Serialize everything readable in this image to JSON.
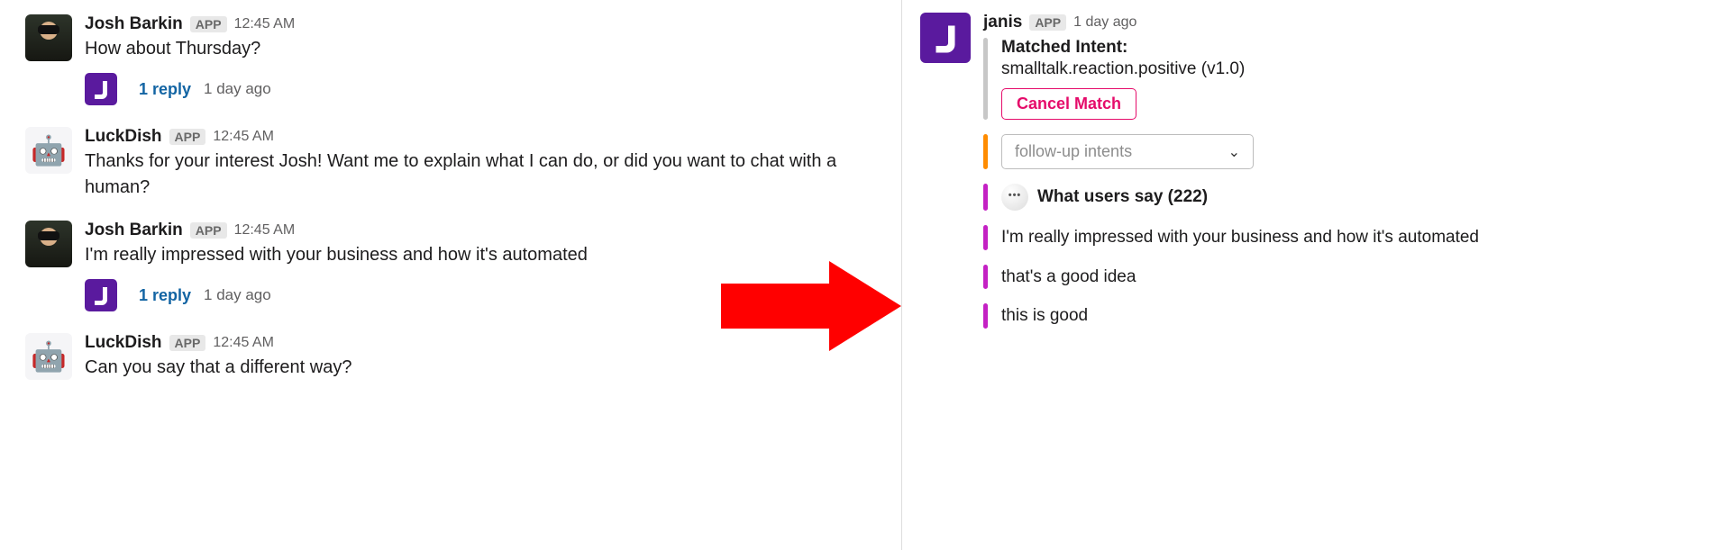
{
  "app_badge": "APP",
  "main": {
    "messages": [
      {
        "author": "Josh Barkin",
        "avatar": "josh",
        "time": "12:45 AM",
        "text": "How about Thursday?",
        "reply": {
          "avatar": "janis-small",
          "link": "1 reply",
          "time": "1 day ago"
        }
      },
      {
        "author": "LuckDish",
        "avatar": "luckdish",
        "time": "12:45 AM",
        "text": "Thanks for your interest Josh! Want me to explain what I can do, or did you want to chat with a human?"
      },
      {
        "author": "Josh Barkin",
        "avatar": "josh",
        "time": "12:45 AM",
        "text": "I'm really impressed with your business and how it's automated",
        "reply": {
          "avatar": "janis-small",
          "link": "1 reply",
          "time": "1 day ago"
        }
      },
      {
        "author": "LuckDish",
        "avatar": "luckdish",
        "time": "12:45 AM",
        "text": "Can you say that a different way?"
      }
    ]
  },
  "side": {
    "author": "janis",
    "avatar": "janis",
    "time": "1 day ago",
    "matched": {
      "title": "Matched Intent:",
      "value": "smalltalk.reaction.positive (v1.0)",
      "cancel": "Cancel Match"
    },
    "followup_placeholder": "follow-up intents",
    "users_say": {
      "title": "What users say (222)",
      "items": [
        "I'm really impressed with your business and how it's automated",
        "that's a good idea",
        "this is good"
      ]
    }
  }
}
